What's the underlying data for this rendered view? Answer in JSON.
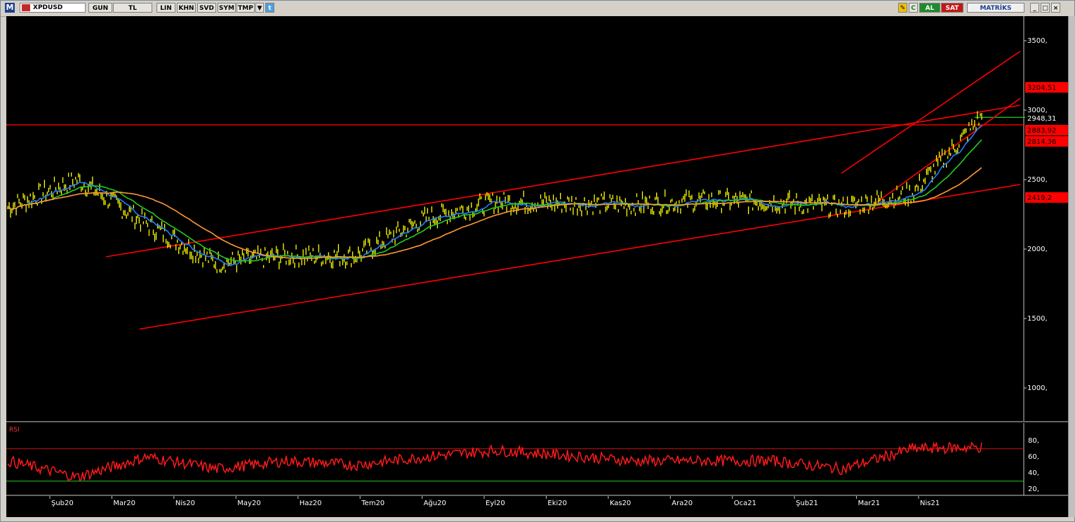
{
  "toolbar": {
    "logo": "M",
    "symbol": "XPDUSD",
    "period": "GUN",
    "currency": "TL",
    "buttons": [
      "LIN",
      "KHN",
      "SVD",
      "SYM",
      "TMP"
    ],
    "buy_label": "AL",
    "sell_label": "SAT",
    "brand": "MATRİKS"
  },
  "price_axis": {
    "ticks": [
      "3500,",
      "3000,",
      "2500,",
      "2000,",
      "1500,",
      "1000,"
    ],
    "tags": [
      {
        "text": "3204,51",
        "color": "#ff0000"
      },
      {
        "text": "2948,31",
        "color": "#000000"
      },
      {
        "text": "2883,92",
        "color": "#ff0000"
      },
      {
        "text": "2814,36",
        "color": "#ff0000"
      },
      {
        "text": "2419,2",
        "color": "#ff0000"
      }
    ]
  },
  "rsi": {
    "label": "RSI",
    "ticks": [
      "80,",
      "60,",
      "40,",
      "20,"
    ],
    "upper": 70,
    "lower": 30
  },
  "time_axis": {
    "labels": [
      "Şub20",
      "Mar20",
      "Nis20",
      "May20",
      "Haz20",
      "Tem20",
      "Ağu20",
      "Eyl20",
      "Eki20",
      "Kas20",
      "Ara20",
      "Oca21",
      "Şub21",
      "Mar21",
      "Nis21"
    ]
  },
  "chart_data": {
    "type": "line",
    "title": "",
    "xlabel": "",
    "ylabel": "",
    "ylim": [
      800,
      3600
    ],
    "grid": false,
    "x": [
      "Şub20",
      "Mar20",
      "Nis20",
      "May20",
      "Haz20",
      "Tem20",
      "Ağu20",
      "Eyl20",
      "Eki20",
      "Kas20",
      "Ara20",
      "Oca21",
      "Şub21",
      "Mar21",
      "Nis21"
    ],
    "series": [
      {
        "values": [
          2300,
          2500,
          2180,
          1900,
          1950,
          1950,
          2220,
          2340,
          2330,
          2320,
          2350,
          2340,
          2300,
          2400,
          2950
        ]
      }
    ],
    "horizontal_lines": [
      2883.92,
      2948.31
    ],
    "rsi_values": [
      55,
      35,
      60,
      45,
      55,
      50,
      60,
      68,
      62,
      55,
      55,
      55,
      45,
      70,
      72
    ]
  },
  "colors": {
    "background": "#000000",
    "price": "#ffff00",
    "ma_fast": "#1e7fff",
    "ma_mid": "#22cc22",
    "ma_slow": "#ff9933",
    "trendline": "#ff0000",
    "axis_line": "#c8c8c8"
  }
}
